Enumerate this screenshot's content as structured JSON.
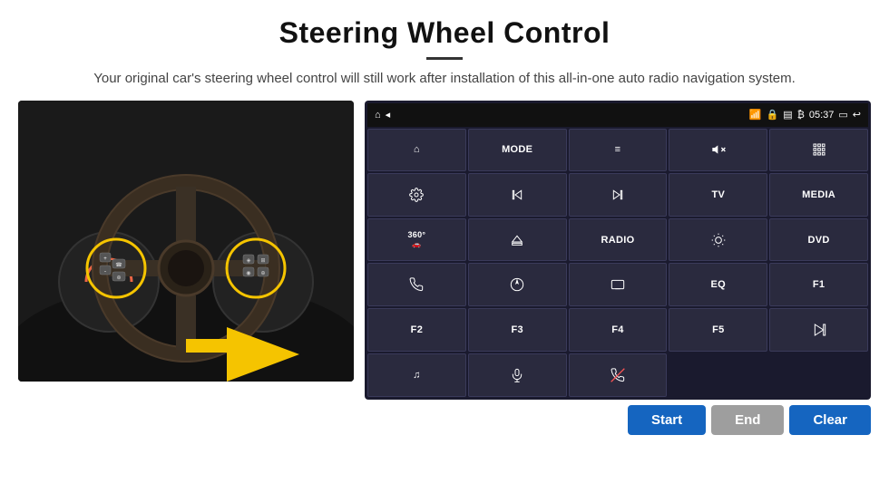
{
  "header": {
    "title": "Steering Wheel Control",
    "subtitle": "Your original car's steering wheel control will still work after installation of this all-in-one auto radio navigation system."
  },
  "statusBar": {
    "time": "05:37",
    "icons": [
      "wifi",
      "lock",
      "sim",
      "bluetooth",
      "battery",
      "window",
      "back"
    ]
  },
  "buttons": [
    [
      {
        "label": "▲",
        "type": "icon",
        "icon": "home"
      },
      {
        "label": "MODE",
        "type": "text"
      },
      {
        "label": "≡",
        "type": "icon"
      },
      {
        "label": "🔇",
        "type": "icon"
      },
      {
        "label": "⠿",
        "type": "icon"
      }
    ],
    [
      {
        "label": "⚙",
        "type": "icon"
      },
      {
        "label": "◄|◄◄",
        "type": "icon"
      },
      {
        "label": "▶▶|►",
        "type": "icon"
      },
      {
        "label": "TV",
        "type": "text"
      },
      {
        "label": "MEDIA",
        "type": "text"
      }
    ],
    [
      {
        "label": "360°",
        "type": "text-small"
      },
      {
        "label": "▲",
        "type": "icon",
        "icon": "eject"
      },
      {
        "label": "RADIO",
        "type": "text"
      },
      {
        "label": "☀",
        "type": "icon"
      },
      {
        "label": "DVD",
        "type": "text"
      }
    ],
    [
      {
        "label": "☎",
        "type": "icon"
      },
      {
        "label": "◎",
        "type": "icon"
      },
      {
        "label": "▭",
        "type": "icon"
      },
      {
        "label": "EQ",
        "type": "text"
      },
      {
        "label": "F1",
        "type": "text"
      }
    ],
    [
      {
        "label": "F2",
        "type": "text"
      },
      {
        "label": "F3",
        "type": "text"
      },
      {
        "label": "F4",
        "type": "text"
      },
      {
        "label": "F5",
        "type": "text"
      },
      {
        "label": "▶⏸",
        "type": "icon"
      }
    ],
    [
      {
        "label": "♪",
        "type": "icon"
      },
      {
        "label": "🎤",
        "type": "icon"
      },
      {
        "label": "◄/↩",
        "type": "icon"
      },
      {
        "label": "",
        "type": "empty"
      },
      {
        "label": "",
        "type": "empty"
      }
    ]
  ],
  "bottomBar": {
    "start_label": "Start",
    "end_label": "End",
    "clear_label": "Clear"
  },
  "colors": {
    "panelBg": "#1a1a2e",
    "btnBg": "#2a2a3e",
    "startBtnBg": "#1565c0",
    "endBtnBg": "#9e9e9e",
    "clearBtnBg": "#1565c0"
  }
}
